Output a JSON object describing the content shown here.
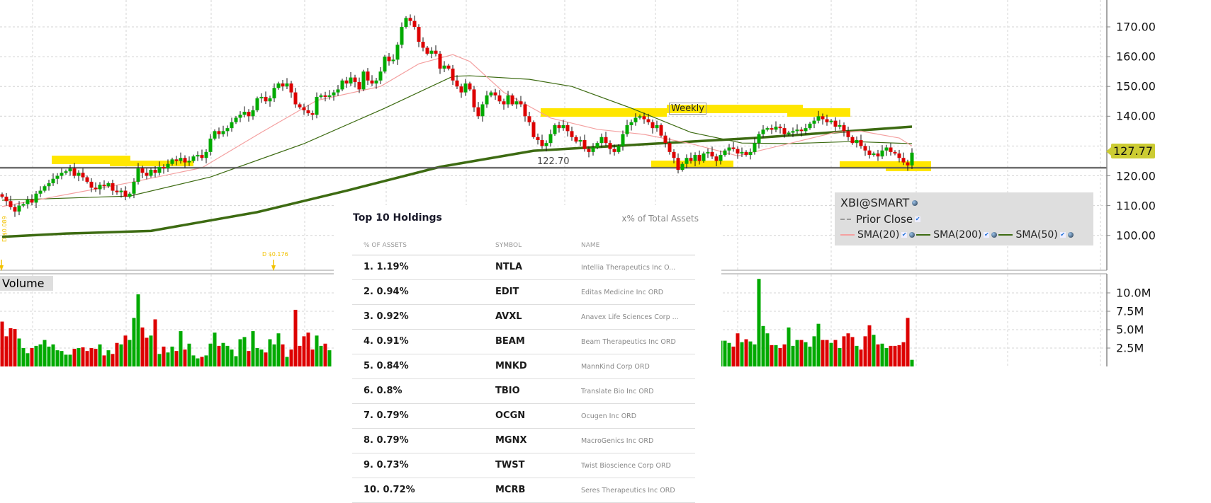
{
  "price_axis": {
    "ticks": [
      "170.00",
      "160.00",
      "150.00",
      "140.00",
      "120.00",
      "110.00",
      "100.00"
    ],
    "tick_values": [
      170,
      160,
      150,
      140,
      120,
      110,
      100
    ],
    "last_price": "127.77"
  },
  "volume_axis": {
    "ticks": [
      "10.0M",
      "7.5M",
      "5.0M",
      "2.5M"
    ],
    "tick_values": [
      10,
      7.5,
      5,
      2.5
    ],
    "title": "Volume"
  },
  "annotations": {
    "weekly": "Weekly",
    "prior_close_value": "122.70",
    "dividend_1": "D $0.089",
    "dividend_2": "D $0.176"
  },
  "legend": {
    "symbol": "XBI@SMART",
    "prior_close": "Prior Close",
    "sma20": "SMA(20)",
    "sma200": "SMA(200)",
    "sma50": "SMA(50)"
  },
  "colors": {
    "up": "#00aa00",
    "down": "#dd0000",
    "sma20": "#f4a0a0",
    "sma50": "#3d6b12",
    "sma200": "#3d6b12",
    "highlight": "#ffe600",
    "last_price_bg": "#cccc33"
  },
  "chart_data": {
    "type": "candlestick",
    "ylim": [
      92,
      178
    ],
    "prior_close": 122.7,
    "close": [
      113,
      111.5,
      109.5,
      108,
      110,
      110.5,
      112,
      111,
      114,
      115,
      116.5,
      117.5,
      119,
      120,
      121,
      121.5,
      122.5,
      120,
      121,
      119.5,
      118,
      116,
      115.5,
      117,
      116.5,
      117.5,
      115,
      114.5,
      115,
      113,
      114,
      118,
      122.5,
      121,
      120,
      122,
      121,
      123,
      122.5,
      124,
      125.5,
      125,
      126,
      124.5,
      125,
      126.5,
      127,
      126,
      128,
      132.5,
      135,
      134,
      135,
      136,
      138,
      139.5,
      140.5,
      141.5,
      140,
      142,
      146,
      146.5,
      145,
      146,
      149.5,
      151,
      150,
      151,
      148,
      144,
      143,
      142,
      141,
      140.5,
      146.5,
      147,
      146.5,
      147,
      148,
      149,
      152,
      151,
      153,
      151.5,
      149,
      155,
      152,
      151,
      152,
      155,
      160,
      158.5,
      159,
      164,
      170,
      173,
      172,
      170,
      165,
      163,
      161,
      162,
      161,
      156,
      157,
      156,
      152,
      150,
      148,
      151,
      149,
      143,
      140,
      144,
      147,
      148,
      147,
      145,
      144,
      147,
      144,
      145,
      144,
      140,
      138,
      133,
      132,
      130,
      131,
      134,
      137,
      136,
      137,
      135,
      133,
      131.5,
      132,
      129,
      128,
      129.5,
      131,
      133,
      131,
      129,
      128,
      130,
      134,
      137,
      138,
      139.5,
      140,
      139,
      138,
      136,
      137,
      133.5,
      131,
      128,
      126,
      122,
      124,
      126,
      125,
      127,
      125,
      127.5,
      128,
      126.5,
      125,
      127,
      128.5,
      129.5,
      129,
      127.5,
      128,
      127,
      128,
      131,
      134,
      135.5,
      136,
      135.5,
      136.5,
      136,
      134,
      134.5,
      135,
      135.5,
      135,
      136,
      137.5,
      138.5,
      140,
      139,
      138,
      138.5,
      136.5,
      137,
      135,
      133,
      131,
      132,
      130,
      128.5,
      127,
      127.5,
      126.5,
      128.5,
      129.5,
      128,
      127.5,
      126,
      124.5,
      123.5,
      127.77
    ],
    "volume_millions": [
      6.1,
      4.1,
      5.2,
      5.1,
      3.8,
      2.5,
      1.8,
      2.5,
      2.8,
      3.0,
      3.6,
      2.7,
      3.0,
      2.2,
      2.1,
      1.6,
      1.6,
      2.4,
      2.5,
      2.6,
      2.1,
      2.5,
      2.4,
      3.0,
      1.5,
      2.2,
      1.7,
      3.2,
      3.0,
      4.2,
      3.6,
      6.6,
      9.8,
      5.3,
      3.9,
      4.2,
      6.4,
      1.7,
      2.7,
      1.9,
      2.7,
      2.1,
      4.8,
      2.3,
      3.1,
      1.5,
      1.1,
      1.3,
      1.5,
      3.1,
      4.6,
      2.8,
      3.2,
      2.8,
      2.3,
      1.4,
      3.7,
      4.0,
      2.1,
      4.8,
      2.5,
      2.3,
      1.9,
      3.7,
      3.0,
      4.5,
      3.0,
      1.3,
      2.3,
      7.7,
      2.8,
      4.1,
      4.6,
      2.3,
      4.2,
      2.8,
      3.1,
      2.2,
      null,
      null,
      null,
      null,
      null,
      null,
      null,
      null,
      null,
      null,
      null,
      null,
      null,
      null,
      null,
      null,
      null,
      null,
      null,
      null,
      null,
      null,
      null,
      null,
      null,
      null,
      null,
      null,
      null,
      null,
      null,
      null,
      null,
      null,
      null,
      null,
      null,
      null,
      null,
      null,
      null,
      null,
      null,
      null,
      null,
      null,
      null,
      null,
      null,
      null,
      null,
      null,
      null,
      null,
      null,
      null,
      null,
      null,
      null,
      null,
      null,
      null,
      null,
      null,
      null,
      null,
      null,
      null,
      null,
      null,
      null,
      null,
      null,
      null,
      null,
      null,
      null,
      null,
      null,
      null,
      null,
      null,
      null,
      null,
      null,
      null,
      null,
      null,
      null,
      null,
      null,
      3.5,
      3.5,
      3.2,
      2.7,
      4.5,
      3.3,
      3.7,
      3.4,
      3.0,
      11.9,
      5.5,
      4.5,
      2.9,
      2.9,
      2.5,
      3.0,
      5.3,
      2.8,
      3.6,
      3.6,
      3.3,
      2.7,
      4.1,
      5.8,
      3.6,
      3.6,
      3.2,
      3.6,
      2.5,
      4.1,
      4.5,
      4.0,
      2.8,
      2.3,
      4.1,
      5.6,
      4.3,
      3.0,
      3.1,
      2.5,
      2.8,
      2.8,
      2.9,
      3.3,
      6.6,
      0.9
    ],
    "sma20": [
      [
        0,
        109.7
      ],
      [
        30,
        117.7
      ],
      [
        47,
        122.7
      ],
      [
        61,
        134.6
      ],
      [
        74,
        145.3
      ],
      [
        89,
        150
      ],
      [
        98,
        157.6
      ],
      [
        106,
        160.7
      ],
      [
        110,
        158.4
      ],
      [
        118,
        148
      ],
      [
        129,
        139.4
      ],
      [
        140,
        135.6
      ],
      [
        151,
        133.9
      ],
      [
        162,
        130.8
      ],
      [
        173,
        126.7
      ],
      [
        185,
        130.8
      ],
      [
        196,
        134.6
      ],
      [
        202,
        135
      ],
      [
        211,
        132.7
      ],
      [
        214,
        130
      ]
    ],
    "sma50": [
      [
        0,
        111.8
      ],
      [
        30,
        113.2
      ],
      [
        49,
        119.6
      ],
      [
        71,
        130.8
      ],
      [
        90,
        142.7
      ],
      [
        106,
        153.4
      ],
      [
        110,
        153.6
      ],
      [
        124,
        152.4
      ],
      [
        134,
        150
      ],
      [
        148,
        142.7
      ],
      [
        162,
        134.6
      ],
      [
        174,
        131
      ],
      [
        185,
        130.8
      ],
      [
        200,
        131.5
      ],
      [
        214,
        130.8
      ]
    ],
    "sma200": [
      [
        0,
        99.5
      ],
      [
        15,
        100.6
      ],
      [
        35,
        101.5
      ],
      [
        60,
        107.8
      ],
      [
        81,
        115
      ],
      [
        103,
        123
      ],
      [
        125,
        128.4
      ],
      [
        150,
        130.5
      ],
      [
        177,
        132.7
      ],
      [
        214,
        136.5
      ]
    ]
  },
  "holdings": {
    "title": "Top 10 Holdings",
    "subtitle": "x% of Total Assets",
    "columns": [
      "% OF ASSETS",
      "SYMBOL",
      "NAME"
    ],
    "rows": [
      {
        "pct": "1. 1.19%",
        "symbol": "NTLA",
        "name": "Intellia Therapeutics Inc O..."
      },
      {
        "pct": "2. 0.94%",
        "symbol": "EDIT",
        "name": "Editas Medicine Inc ORD"
      },
      {
        "pct": "3. 0.92%",
        "symbol": "AVXL",
        "name": "Anavex Life Sciences Corp ..."
      },
      {
        "pct": "4. 0.91%",
        "symbol": "BEAM",
        "name": "Beam Therapeutics Inc ORD"
      },
      {
        "pct": "5. 0.84%",
        "symbol": "MNKD",
        "name": "MannKind Corp ORD"
      },
      {
        "pct": "6. 0.8%",
        "symbol": "TBIO",
        "name": "Translate Bio Inc ORD"
      },
      {
        "pct": "7. 0.79%",
        "symbol": "OCGN",
        "name": "Ocugen Inc ORD"
      },
      {
        "pct": "8. 0.79%",
        "symbol": "MGNX",
        "name": "MacroGenics Inc ORD"
      },
      {
        "pct": "9. 0.73%",
        "symbol": "TWST",
        "name": "Twist Bioscience Corp ORD"
      },
      {
        "pct": "10. 0.72%",
        "symbol": "MCRB",
        "name": "Seres Therapeutics Inc ORD"
      }
    ]
  }
}
